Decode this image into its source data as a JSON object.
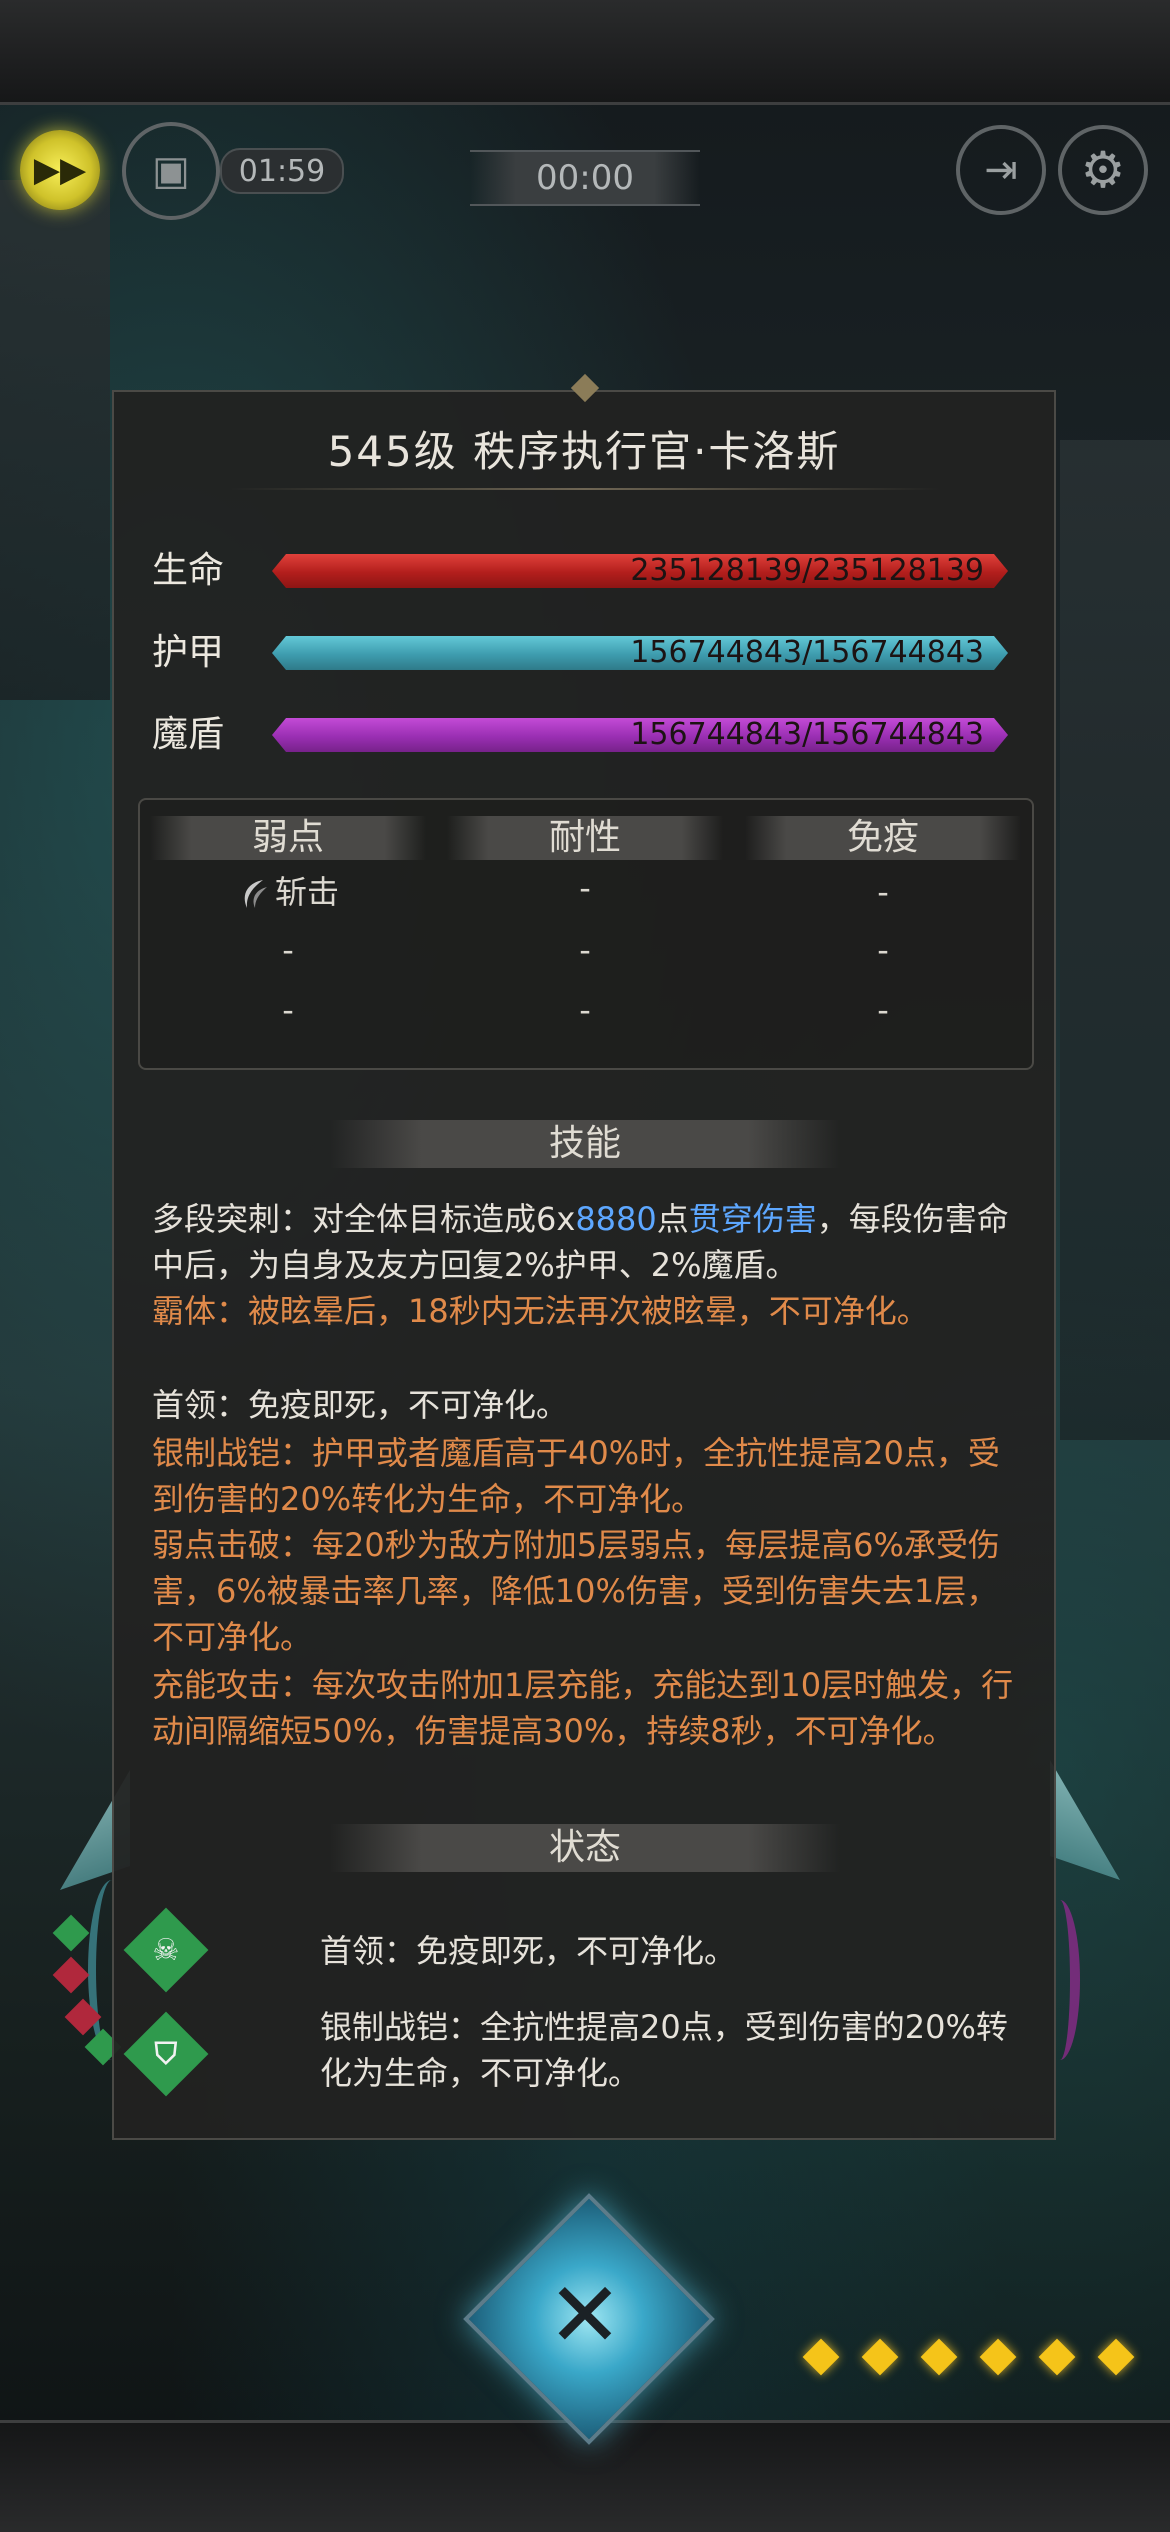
{
  "hud": {
    "fast_forward_icon": "fast-forward-icon",
    "auto_icon": "auto-battle-icon",
    "countdown": "01:59",
    "battle_timer": "00:00",
    "exit_icon": "exit-icon",
    "settings_icon": "gear-icon"
  },
  "boss": {
    "title": "545级  秩序执行官·卡洛斯"
  },
  "stats": {
    "hp": {
      "label": "生命",
      "value": "235128139/235128139",
      "fill": 1.0,
      "color": "#c8241f"
    },
    "armor": {
      "label": "护甲",
      "value": "156744843/156744843",
      "fill": 1.0,
      "color": "#4aaec0"
    },
    "shield": {
      "label": "魔盾",
      "value": "156744843/156744843",
      "fill": 1.0,
      "color": "#a535c0"
    }
  },
  "resist": {
    "headers": [
      "弱点",
      "耐性",
      "免疫"
    ],
    "rows": [
      [
        "斩击",
        "-",
        "-"
      ],
      [
        "-",
        "-",
        "-"
      ],
      [
        "-",
        "-",
        "-"
      ]
    ]
  },
  "skills": {
    "header": "技能",
    "s1_prefix": "多段突刺：对全体目标造成6x",
    "s1_num": "8880",
    "s1_mid": "点",
    "s1_type": "贯穿伤害",
    "s1_rest": "，每段伤害命中后，为自身及友方回复2%护甲、2%魔盾。",
    "s2": "霸体：被眩晕后，18秒内无法再次被眩晕，不可净化。",
    "s3": "首领：免疫即死，不可净化。",
    "s4": "银制战铠：护甲或者魔盾高于40%时，全抗性提高20点，受到伤害的20%转化为生命，不可净化。",
    "s5": "弱点击破：每20秒为敌方附加5层弱点，每层提高6%承受伤害，6%被暴击率几率，降低10%伤害，受到伤害失去1层，不可净化。",
    "s6": "充能攻击：每次攻击附加1层充能，充能达到10层时触发，行动间隔缩短50%，伤害提高30%，持续8秒，不可净化。"
  },
  "status": {
    "header": "状态",
    "items": [
      {
        "icon": "skull-icon",
        "text": "首领：免疫即死，不可净化。"
      },
      {
        "icon": "armor-shield-icon",
        "text": "银制战铠：全抗性提高20点，受到伤害的20%转化为生命，不可净化。"
      }
    ]
  },
  "bottom": {
    "cancel_icon": "crossed-swords-icon",
    "energy_count": 6
  }
}
